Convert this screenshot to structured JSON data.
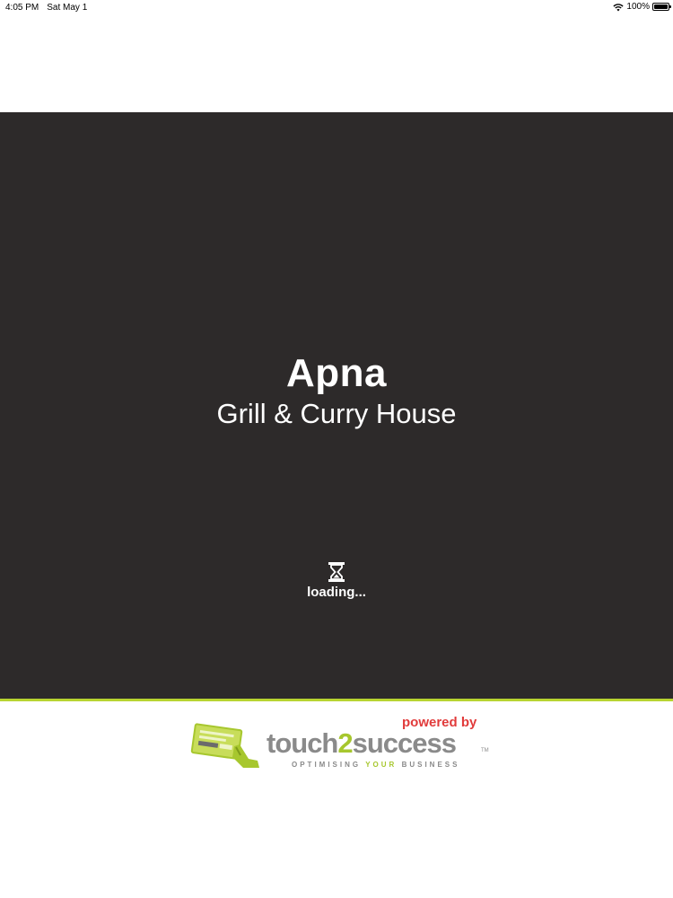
{
  "status_bar": {
    "time": "4:05 PM",
    "date": "Sat May 1",
    "battery": "100%",
    "icons": [
      "wifi-icon",
      "battery-icon"
    ]
  },
  "splash": {
    "title": "Apna",
    "subtitle": "Grill & Curry House",
    "loading_text": "loading...",
    "loading_icon": "hourglass-icon"
  },
  "footer_logo": {
    "powered_by": "powered by",
    "wordmark_part1": "touch",
    "wordmark_number": "2",
    "wordmark_part2": "success",
    "trademark": "TM",
    "tagline_part1": "OPTIMISING",
    "tagline_your": "YOUR",
    "tagline_part2": "BUSINESS",
    "logo_icon": "touch-card-icon"
  },
  "colors": {
    "splash_background": "#2d2a2a",
    "accent": "#b8d431",
    "powered_by": "#e13b3b",
    "wordmark_grey": "#8a8a8a"
  }
}
